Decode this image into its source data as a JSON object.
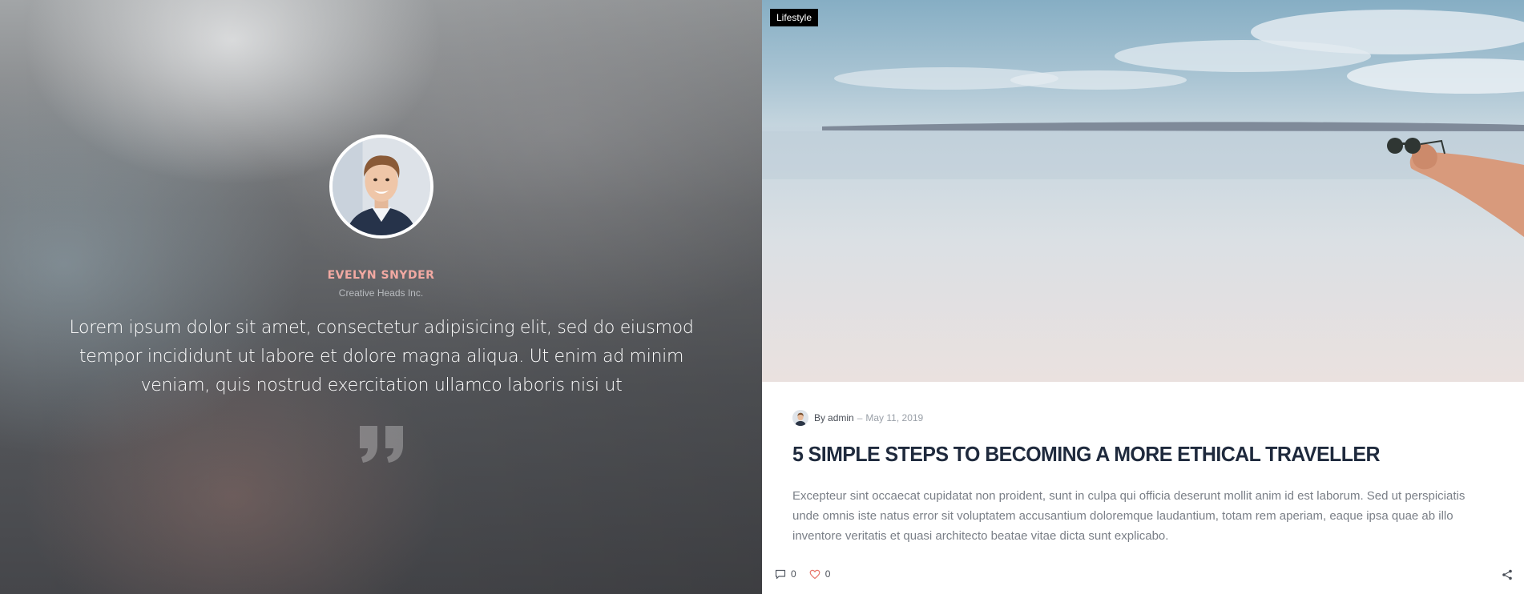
{
  "testimonial": {
    "name": "EVELYN SNYDER",
    "company": "Creative Heads Inc.",
    "text": "Lorem ipsum dolor sit amet, consectetur adipisicing elit, sed do eiusmod tempor incididunt ut labore et dolore magna aliqua. Ut enim ad minim veniam, quis nostrud exercitation ullamco laboris nisi ut",
    "name_color": "#f2a9a2",
    "icons": {
      "avatar": "avatar-photo",
      "quote": "quote-icon"
    }
  },
  "post": {
    "category": "Lifestyle",
    "by_label": "By",
    "author": "admin",
    "separator": "–",
    "date": "May 11, 2019",
    "title": "5 SIMPLE STEPS TO BECOMING A MORE ETHICAL TRAVELLER",
    "excerpt": "Excepteur sint occaecat cupidatat non proident, sunt in culpa qui officia deserunt mollit anim id est laborum. Sed ut perspiciatis unde omnis iste natus error sit voluptatem accusantium doloremque laudantium, totam rem aperiam, eaque ipsa quae ab illo inventore veritatis et quasi architecto beatae vitae dicta sunt explicabo.",
    "comments_count": "0",
    "likes_count": "0",
    "icons": {
      "comments": "comment-icon",
      "likes": "heart-icon",
      "share": "share-icon"
    },
    "colors": {
      "title": "#1f2a3d",
      "heart": "#e8766b",
      "badge_bg": "#000000"
    }
  }
}
